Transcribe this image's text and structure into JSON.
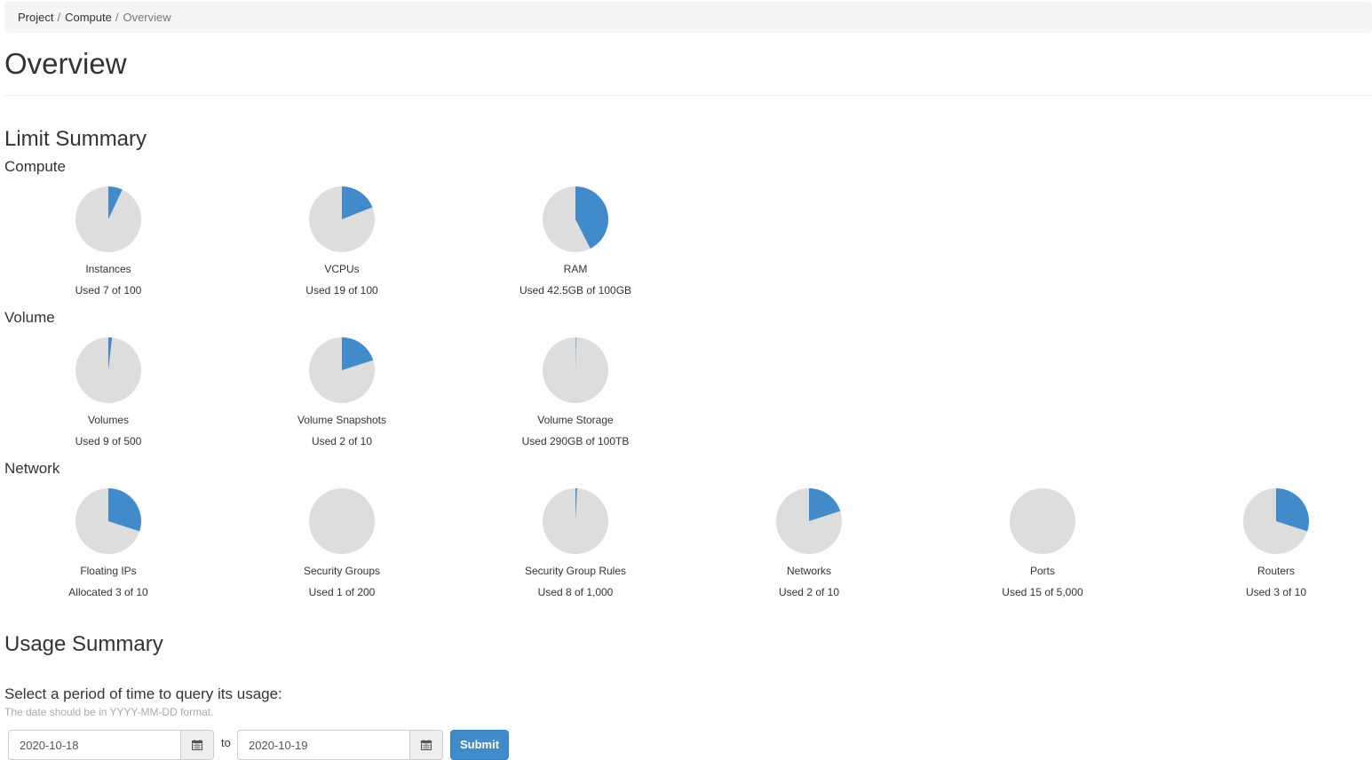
{
  "breadcrumb": [
    {
      "label": "Project"
    },
    {
      "label": "Compute"
    },
    {
      "label": "Overview"
    }
  ],
  "breadcrumb_separator": "/",
  "page_title": "Overview",
  "limit_summary": {
    "title": "Limit Summary",
    "colors": {
      "used": "#428bca",
      "free": "#dddddd"
    },
    "groups": [
      {
        "title": "Compute",
        "items": [
          {
            "label": "Instances",
            "stat": "Used 7 of 100",
            "used": 7,
            "total": 100
          },
          {
            "label": "VCPUs",
            "stat": "Used 19 of 100",
            "used": 19,
            "total": 100
          },
          {
            "label": "RAM",
            "stat": "Used 42.5GB of 100GB",
            "used": 42.5,
            "total": 100
          }
        ]
      },
      {
        "title": "Volume",
        "items": [
          {
            "label": "Volumes",
            "stat": "Used 9 of 500",
            "used": 9,
            "total": 500
          },
          {
            "label": "Volume Snapshots",
            "stat": "Used 2 of 10",
            "used": 2,
            "total": 10
          },
          {
            "label": "Volume Storage",
            "stat": "Used 290GB of 100TB",
            "used": 290,
            "total": 102400
          }
        ]
      },
      {
        "title": "Network",
        "items": [
          {
            "label": "Floating IPs",
            "stat": "Allocated 3 of 10",
            "used": 3,
            "total": 10
          },
          {
            "label": "Security Groups",
            "stat": "Used 1 of 200",
            "used": 0,
            "total": 200
          },
          {
            "label": "Security Group Rules",
            "stat": "Used 8 of 1,000",
            "used": 8,
            "total": 1000
          },
          {
            "label": "Networks",
            "stat": "Used 2 of 10",
            "used": 2,
            "total": 10
          },
          {
            "label": "Ports",
            "stat": "Used 15 of 5,000",
            "used": 0,
            "total": 5000
          },
          {
            "label": "Routers",
            "stat": "Used 3 of 10",
            "used": 3,
            "total": 10
          }
        ]
      }
    ]
  },
  "usage_summary": {
    "title": "Usage Summary",
    "prompt": "Select a period of time to query its usage:",
    "help": "The date should be in YYYY-MM-DD format.",
    "start_date": "2020-10-18",
    "to_label": "to",
    "end_date": "2020-10-19",
    "submit_label": "Submit",
    "calendar_icon": "calendar-icon"
  }
}
